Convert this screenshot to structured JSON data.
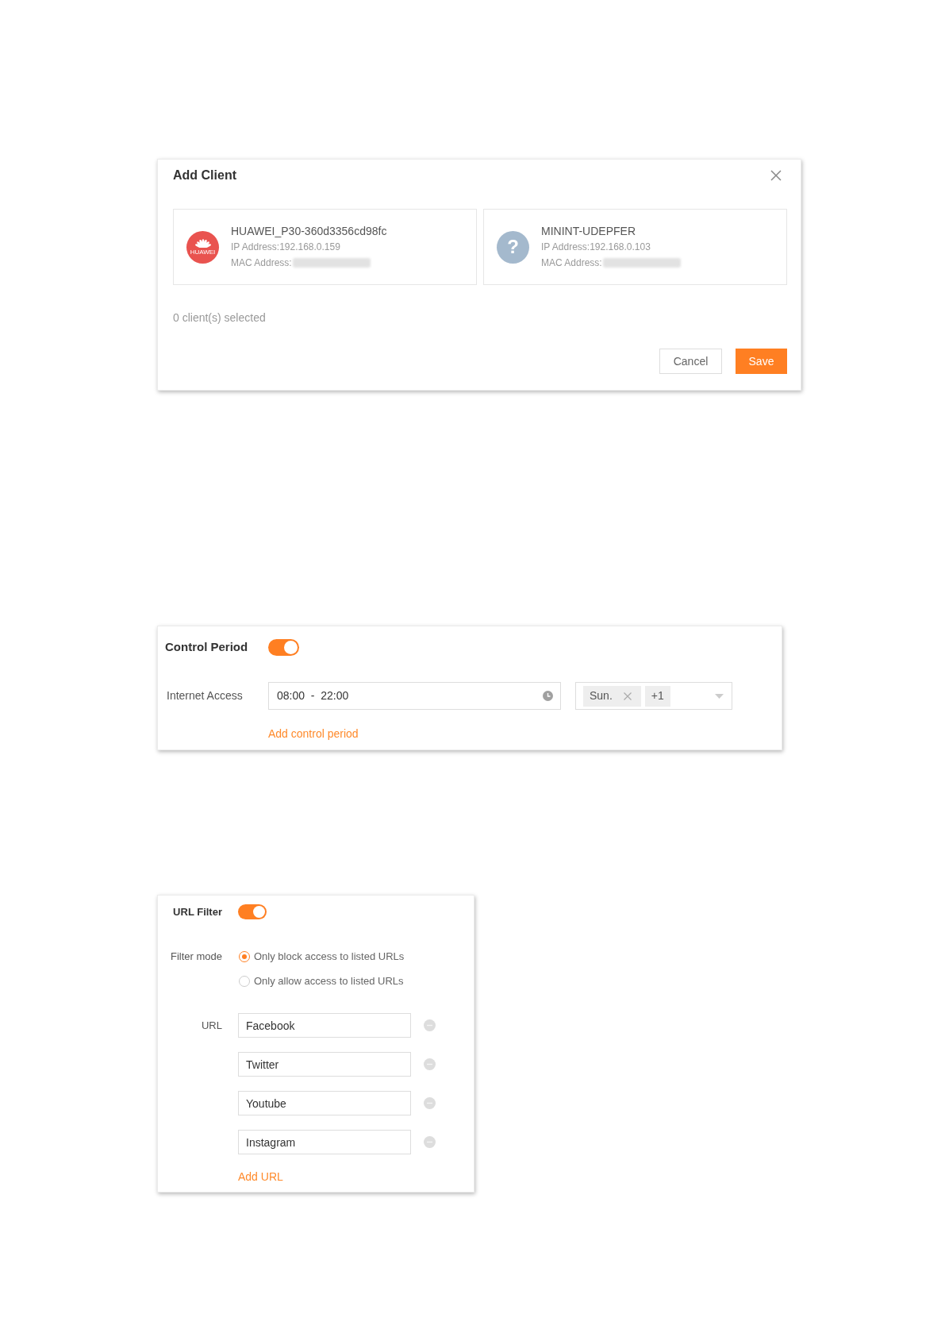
{
  "add_client_dialog": {
    "title": "Add Client",
    "clients": [
      {
        "avatar": {
          "kind": "logo",
          "text": "HUAWEI"
        },
        "name": "HUAWEI_P30-360d3356cd98fc",
        "ip": "IP Address:192.168.0.159",
        "mac_label": "MAC Address:",
        "mac_blurred": true
      },
      {
        "avatar": {
          "kind": "unknown",
          "glyph": "?"
        },
        "name": "MININT-UDEPFER",
        "ip": "IP Address:192.168.0.103",
        "mac_label": "MAC Address:",
        "mac_blurred": true
      }
    ],
    "selection_summary": "0 client(s) selected",
    "buttons": [
      {
        "label": "Cancel",
        "kind": "secondary"
      },
      {
        "label": "Save",
        "kind": "primary"
      }
    ]
  },
  "control_period": {
    "title": "Control Period",
    "on": true,
    "periods": [
      {
        "label": "Internet Access",
        "time_range": "08:00  -  22:00",
        "days": [
          {
            "label": "Sun.",
            "removable": true
          },
          {
            "label": "+1",
            "removable": false
          }
        ]
      }
    ],
    "add_link": "Add control period"
  },
  "url_filter": {
    "title": "URL Filter",
    "on": true,
    "filter_mode": {
      "label": "Filter mode",
      "options": [
        {
          "label": "Only block access to listed URLs",
          "selected": true
        },
        {
          "label": "Only allow access to listed URLs",
          "selected": false
        }
      ]
    },
    "urls": {
      "label": "URL",
      "entries": [
        {
          "value": "Facebook"
        },
        {
          "value": "Twitter"
        },
        {
          "value": "Youtube"
        },
        {
          "value": "Instagram"
        }
      ]
    },
    "add_link": "Add URL"
  }
}
